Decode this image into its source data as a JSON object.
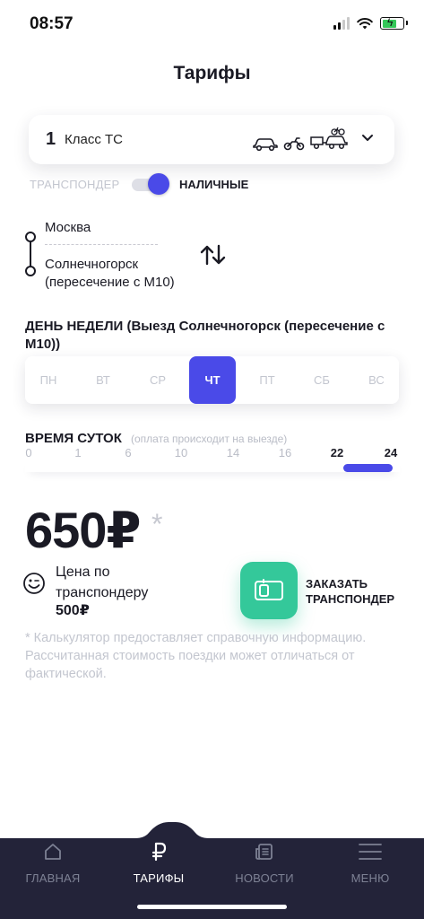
{
  "status": {
    "time": "08:57"
  },
  "header": {
    "title": "Тарифы"
  },
  "vehicle_class": {
    "number": "1",
    "label": "Класс ТС"
  },
  "payment": {
    "transponder_label": "ТРАНСПОНДЕР",
    "cash_label": "НАЛИЧНЫЕ",
    "transponder_selected": false
  },
  "route": {
    "from": "Москва",
    "to_line1": "Солнечногорск",
    "to_line2": "(пересечение с М10)"
  },
  "day_of_week": {
    "title": "ДЕНЬ НЕДЕЛИ (Выезд Солнечногорск (пересечение с М10))",
    "days": [
      "ПН",
      "ВТ",
      "СР",
      "ЧТ",
      "ПТ",
      "СБ",
      "ВС"
    ],
    "selected": "ЧТ"
  },
  "time": {
    "title": "ВРЕМЯ СУТОК",
    "note": "(оплата происходит на выезде)",
    "ticks": [
      "0",
      "1",
      "6",
      "10",
      "14",
      "16",
      "22",
      "24"
    ],
    "selected_ticks": [
      "22",
      "24"
    ],
    "range": [
      0.865,
      1.0
    ]
  },
  "price": {
    "value": "650",
    "currency": "₽",
    "asterisk": "*",
    "transponder_label_line1": "Цена по",
    "transponder_label_line2": "транспондеру",
    "transponder_value": "500₽"
  },
  "order": {
    "line1": "ЗАКАЗАТЬ",
    "line2": "ТРАНСПОНДЕР"
  },
  "disclaimer": "* Калькулятор предоставляет справочную информацию. Рассчитанная стоимость поездки может отличаться от фактической.",
  "tabs": [
    {
      "label": "ГЛАВНАЯ",
      "icon": "home-icon",
      "active": false
    },
    {
      "label": "ТАРИФЫ",
      "icon": "ruble-icon",
      "active": true
    },
    {
      "label": "НОВОСТИ",
      "icon": "news-icon",
      "active": false
    },
    {
      "label": "МЕНЮ",
      "icon": "menu-icon",
      "active": false
    }
  ],
  "colors": {
    "accent": "#4a4ae8",
    "green": "#34c89a",
    "tabbar": "#232339",
    "muted": "#c3c6cf"
  }
}
